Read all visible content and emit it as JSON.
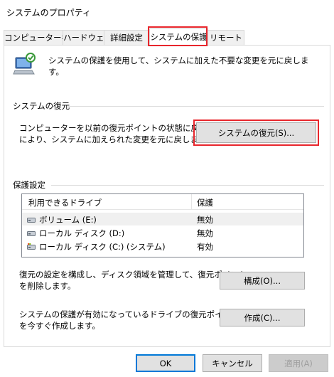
{
  "window": {
    "title": "システムのプロパティ"
  },
  "tabs": [
    {
      "label": "コンピューター名"
    },
    {
      "label": "ハードウェア"
    },
    {
      "label": "詳細設定"
    },
    {
      "label": "システムの保護"
    },
    {
      "label": "リモート"
    }
  ],
  "active_tab": "システムの保護",
  "intro": {
    "text": "システムの保護を使用して、システムに加えた不要な変更を元に戻します。",
    "icon": "computer-protection-icon"
  },
  "restore": {
    "section_label": "システムの復元",
    "description_line1": "コンピューターを以前の復元ポイントの状態に戻すこと",
    "description_line2": "により、システムに加えられた変更を元に戻します。",
    "button_label": "システムの復元(S)..."
  },
  "protection": {
    "section_label": "保護設定",
    "columns": [
      "利用できるドライブ",
      "保護"
    ],
    "drives": [
      {
        "name": "ボリューム (E:)",
        "status": "無効",
        "icon": "drive-icon"
      },
      {
        "name": "ローカル ディスク (D:)",
        "status": "無効",
        "icon": "drive-icon"
      },
      {
        "name": "ローカル ディスク (C:) (システム)",
        "status": "有効",
        "icon": "system-drive-icon"
      }
    ]
  },
  "configure": {
    "description_line1": "復元の設定を構成し、ディスク領域を管理して、復元ポイント",
    "description_line2": "を削除します。",
    "button_label": "構成(O)..."
  },
  "create": {
    "description_line1": "システムの保護が有効になっているドライブの復元ポイント",
    "description_line2": "を今すぐ作成します。",
    "button_label": "作成(C)..."
  },
  "footer": {
    "ok_label": "OK",
    "cancel_label": "キャンセル",
    "apply_label": "適用(A)"
  },
  "colors": {
    "highlight": "#e8262c",
    "default_button_border": "#0078d7",
    "button_face": "#e1e1e1",
    "accent_green": "#3a9a3a"
  }
}
